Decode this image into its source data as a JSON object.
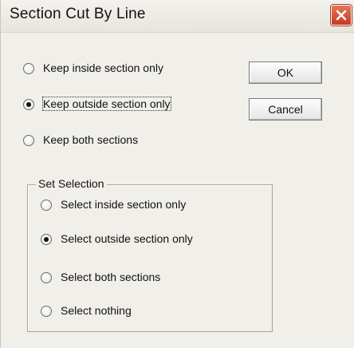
{
  "window": {
    "title": "Section Cut By Line"
  },
  "keep_options": [
    {
      "label": "Keep inside section only",
      "checked": false,
      "focused": false
    },
    {
      "label": "Keep outside section only",
      "checked": true,
      "focused": true
    },
    {
      "label": "Keep both sections",
      "checked": false,
      "focused": false
    }
  ],
  "buttons": {
    "ok": "OK",
    "cancel": "Cancel"
  },
  "selection_group": {
    "title": "Set Selection",
    "options": [
      {
        "label": "Select inside section only",
        "checked": false
      },
      {
        "label": "Select outside section only",
        "checked": true
      },
      {
        "label": "Select both sections",
        "checked": false
      },
      {
        "label": "Select nothing",
        "checked": false
      }
    ]
  },
  "icons": {
    "close": "close-icon"
  }
}
